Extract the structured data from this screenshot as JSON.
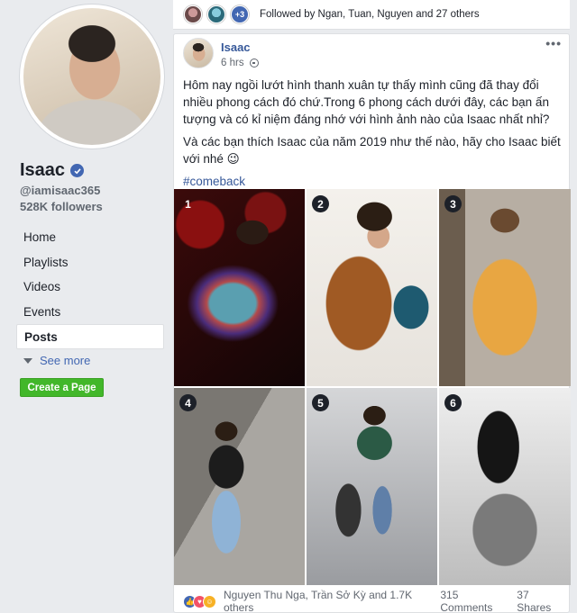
{
  "page": {
    "name": "Isaac",
    "handle": "@iamisaac365",
    "followers": "528K followers"
  },
  "nav": {
    "items": [
      "Home",
      "Playlists",
      "Videos",
      "Events",
      "Posts"
    ],
    "active": "Posts",
    "see_more": "See more",
    "create_page": "Create a Page"
  },
  "followed_by": {
    "extra_count": "+3",
    "text": "Followed by Ngan, Tuan, Nguyen and 27 others"
  },
  "post": {
    "author": "Isaac",
    "time": "6 hrs",
    "text1": "Hôm nay ngồi lướt hình thanh xuân tự thấy mình cũng đã thay đổi nhiều phong cách đó chứ.Trong 6 phong cách dưới đây, các bạn ấn tượng và có kỉ niệm đáng nhớ với hình ảnh nào của Isaac nhất nhỉ?",
    "text2": "Và các bạn thích Isaac của năm 2019 như thế nào, hãy cho Isaac biết với nhé 😉",
    "hashtag": "#comeback",
    "photo_labels": [
      "1",
      "2",
      "3",
      "4",
      "5",
      "6"
    ],
    "reactions_text": "Nguyen Thu Nga, Trần Sở Kỳ and 1.7K others",
    "comments": "315 Comments",
    "shares": "37 Shares"
  },
  "icons": {
    "verified": "verified-check-icon",
    "privacy": "globe-icon",
    "more": "more-options-icon",
    "reactions": [
      "like-icon",
      "love-icon",
      "haha-icon"
    ]
  },
  "colors": {
    "link_blue": "#365899",
    "fb_blue": "#4267b2",
    "create_green": "#42b72a",
    "background": "#e9ebee"
  }
}
